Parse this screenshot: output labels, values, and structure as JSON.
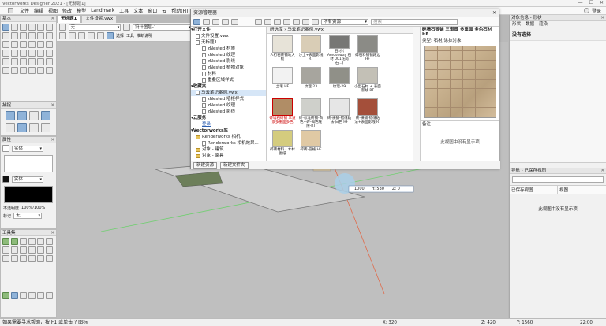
{
  "title_bar": {
    "title": "Vectorworks Designer 2021 - [无标题1]",
    "controls": [
      "—",
      "☐",
      "✕"
    ]
  },
  "menu": {
    "items": [
      "文件",
      "编辑",
      "视图",
      "修改",
      "模型",
      "Landmark",
      "工具",
      "文本",
      "窗口",
      "云",
      "帮助(H)"
    ],
    "right_label": "登录"
  },
  "left_palettes": {
    "basic": {
      "title": "基本"
    },
    "snap": {
      "title": "捕捉"
    },
    "attributes": {
      "title": "属性",
      "fill_value": "实体",
      "pen_value": "实体",
      "opacity_label": "不透明度",
      "opacity_value": "100%/100%",
      "marker_label": "标记",
      "marker_value": "无"
    },
    "tool_set": {
      "title": "工具集"
    }
  },
  "doc_tabs": [
    {
      "label": "无标题1",
      "active": true
    },
    {
      "label": "文件设置.vwx",
      "active": false
    }
  ],
  "view_bar": {
    "class_value": "无",
    "layer_value": "设计图层-1",
    "buttons": [
      "选择",
      "工具",
      "推断说明"
    ]
  },
  "resource_manager": {
    "title": "资源管理器",
    "path": "马云笔记案例.vwx",
    "breadcrumb_root": "所选库",
    "filter_value": "所有资源",
    "search_placeholder": "搜索",
    "tree": [
      {
        "type": "section",
        "label": "打开文件"
      },
      {
        "type": "doc",
        "label": "文件设置.vwx"
      },
      {
        "type": "doc",
        "label": "无标题1"
      },
      {
        "type": "file",
        "label": "zNested 材质"
      },
      {
        "type": "file",
        "label": "zNested 纹理"
      },
      {
        "type": "file",
        "label": "zNested 影线"
      },
      {
        "type": "file",
        "label": "zNested 植物对象"
      },
      {
        "type": "file",
        "label": "材料"
      },
      {
        "type": "file",
        "label": "重叠区域样式"
      },
      {
        "type": "section",
        "label": "收藏夹"
      },
      {
        "type": "doc",
        "label": "马云笔记案例.vwx",
        "selected": true
      },
      {
        "type": "file",
        "label": "zNested 墙柜样式"
      },
      {
        "type": "file",
        "label": "zNested 纹理"
      },
      {
        "type": "file",
        "label": "zNested 影线"
      },
      {
        "type": "section",
        "label": "云服务"
      },
      {
        "type": "link",
        "label": "登录"
      },
      {
        "type": "section",
        "label": "Vectorworks库"
      },
      {
        "type": "file",
        "label": "Renderworks 相机"
      },
      {
        "type": "file",
        "label": "Renderworks 相机效果..."
      },
      {
        "type": "file",
        "label": "对象 - 建筑"
      },
      {
        "type": "file",
        "label": "对象 - 家具"
      }
    ],
    "tiles": [
      {
        "label": "人行石砖铺地大板",
        "color": "#e7e3d8"
      },
      {
        "label": "沙土+表面影线 RT",
        "color": "#d9cdb6"
      },
      {
        "label": "石材 ( Amoseway 石材 001花岗石...)",
        "color": "#777775"
      },
      {
        "label": "碎石料铺铺路边 HF",
        "color": "#8b8b86"
      },
      {
        "label": "",
        "color": "#f4f4f4"
      },
      {
        "label": "土壤 HF",
        "color": "#f2f2f2"
      },
      {
        "label": "纹理-23",
        "color": "#a7a59e"
      },
      {
        "label": "纹理-29",
        "color": "#909088"
      },
      {
        "label": "小型石材 + 表面影线 RT",
        "color": "#c3c0b6"
      },
      {
        "label": "",
        "color": "#f4f4f4"
      },
      {
        "label": "砖墙石砖铺 三道景多重面多色",
        "color": "#b08d66",
        "selected": true
      },
      {
        "label": "砖-标准砖铺-白色+砖-褐色缝隙-RT",
        "color": "#cfd0cb"
      },
      {
        "label": "砖-横铺-错缝粘法-白色 HF",
        "color": "#e6e6e6"
      },
      {
        "label": "砖-横铺-错缝粘法+表面影线 RT",
        "color": "#a44f3a"
      },
      {
        "label": "",
        "color": "#f4f4f4"
      },
      {
        "label": "碎砖材料 - 木材图纸",
        "color": "#d4cc7e"
      },
      {
        "label": "碎砖-圆格 HF",
        "color": "#e0c9a4"
      }
    ],
    "preview": {
      "title": "碎墙石砖铺 三道景 多重面 多色石材 HF",
      "type_prefix": "类型:",
      "type_value": "石材/涂抹对象",
      "section_label": "备注",
      "empty_text": "此视图中没有显示项"
    },
    "footer_buttons": [
      "新建资源",
      "新建文件夹"
    ]
  },
  "canvas": {
    "dimension_label": "1000",
    "coord_y_label": "Y: 530",
    "coord_z_label": "Z: 0"
  },
  "right_panel": {
    "obj_info_title": "对象信息 - 形状",
    "obj_tabs": [
      "形状",
      "数据",
      "渲染"
    ],
    "no_selection": "没有选择",
    "nav_title": "导航 - 已保存视图",
    "nav_placeholder": "",
    "nav_columns": [
      "已保存视图",
      "视图"
    ],
    "nav_empty": "此视图中没有显示项"
  },
  "status_bar": {
    "message": "如果需要寻求帮助，按 F1 或单击 ? 图标",
    "x_value": "X: 320",
    "y_value": "Y: 1560",
    "z_value": "Z: 420",
    "zoom_value": "22:00"
  }
}
